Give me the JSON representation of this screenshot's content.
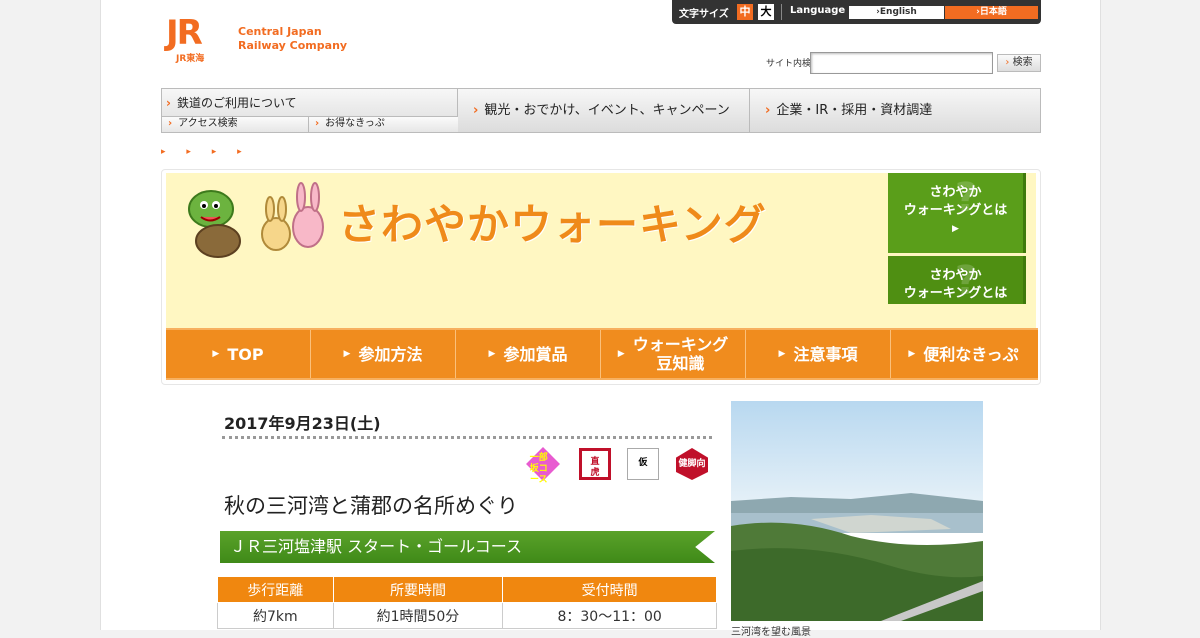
{
  "header": {
    "logo_text": "JR",
    "logo_sub": "JR東海",
    "company_name": "Central Japan\nRailway Company"
  },
  "util_bar": {
    "font_size_label": "文字サイズ",
    "font_size_medium": "中",
    "font_size_large": "大",
    "language_label": "Language",
    "english_label": "English",
    "japanese_label": "日本語"
  },
  "search": {
    "label": "サイト内検索",
    "placeholder": "",
    "button_label": "検索"
  },
  "gnav": {
    "rail": "鉄道のご利用について",
    "access": "アクセス検索",
    "tickets": "お得なきっぷ",
    "tourism": "観光・おでかけ、イベント、キャンペーン",
    "corporate": "企業・IR・採用・資材調達"
  },
  "breadcrumb": "▸ ▸ ▸ ▸",
  "banner": {
    "title": "さわやかウォーキング",
    "about_1_line1": "さわやか",
    "about_1_line2": "ウォーキングとは",
    "about_2_line1": "さわやか",
    "about_2_line2": "ウォーキングとは"
  },
  "subnav": [
    {
      "label": "TOP"
    },
    {
      "label": "参加方法"
    },
    {
      "label": "参加賞品"
    },
    {
      "label": "ウォーキング\n豆知識"
    },
    {
      "label": "注意事項"
    },
    {
      "label": "便利なきっぷ"
    }
  ],
  "event": {
    "date": "2017年9月23日(土)",
    "course_title": "秋の三河湾と蒲郡の名所めぐり",
    "course_bar": "ＪＲ三河塩津駅 スタート・ゴールコース",
    "badges": {
      "b1": "一部\n坂コース",
      "b2": "直\n虎",
      "b3": "仮",
      "b4": "健脚向"
    },
    "table": {
      "headers": [
        "歩行距離",
        "所要時間",
        "受付時間"
      ],
      "row": [
        "約7km",
        "約1時間50分",
        "8：30～11：00"
      ]
    },
    "photo_caption": "三河湾を望む風景"
  },
  "colors": {
    "brand_orange": "#f26c21",
    "banner_bg": "#fff7c2",
    "green": "#5a9e1a",
    "table_header": "#f0870f"
  }
}
